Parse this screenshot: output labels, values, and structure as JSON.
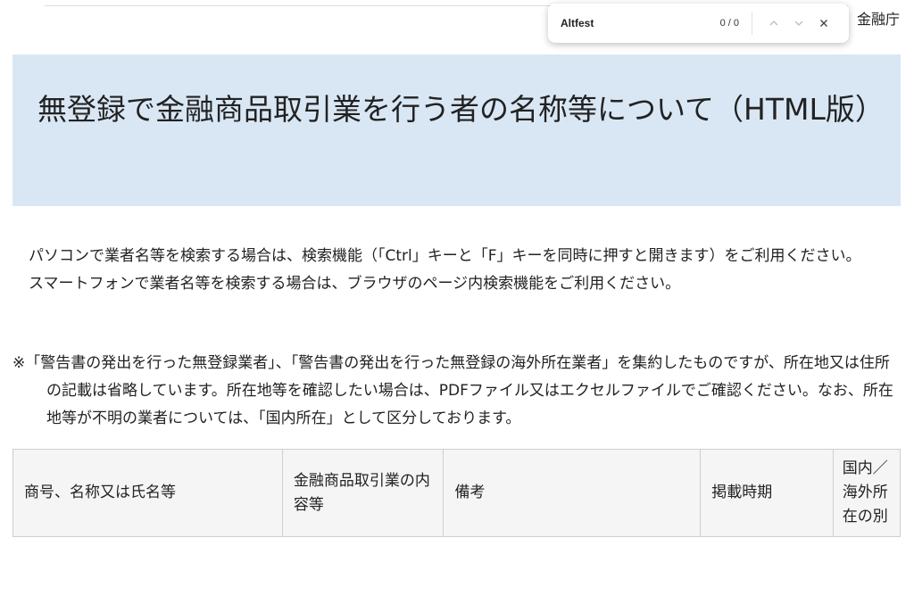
{
  "site": {
    "org_name": "金融庁"
  },
  "find_bar": {
    "query": "Altfest",
    "count": "0 / 0"
  },
  "header": {
    "title": "無登録で金融商品取引業を行う者の名称等について（HTML版）"
  },
  "intro": {
    "line1": "パソコンで業者名等を検索する場合は、検索機能（「Ctrl」キーと「F」キーを同時に押すと開きます）をご利用ください。",
    "line2": "スマートフォンで業者名等を検索する場合は、ブラウザのページ内検索機能をご利用ください。"
  },
  "note": {
    "text": "※「警告書の発出を行った無登録業者」、「警告書の発出を行った無登録の海外所在業者」を集約したものですが、所在地又は住所の記載は省略しています。所在地等を確認したい場合は、PDFファイル又はエクセルファイルでご確認ください。なお、所在地等が不明の業者については、「国内所在」として区分しております。"
  },
  "table": {
    "headers": [
      "商号、名称又は氏名等",
      "金融商品取引業の内容等",
      "備考",
      "掲載時期",
      "国内／海外所在の別"
    ]
  }
}
